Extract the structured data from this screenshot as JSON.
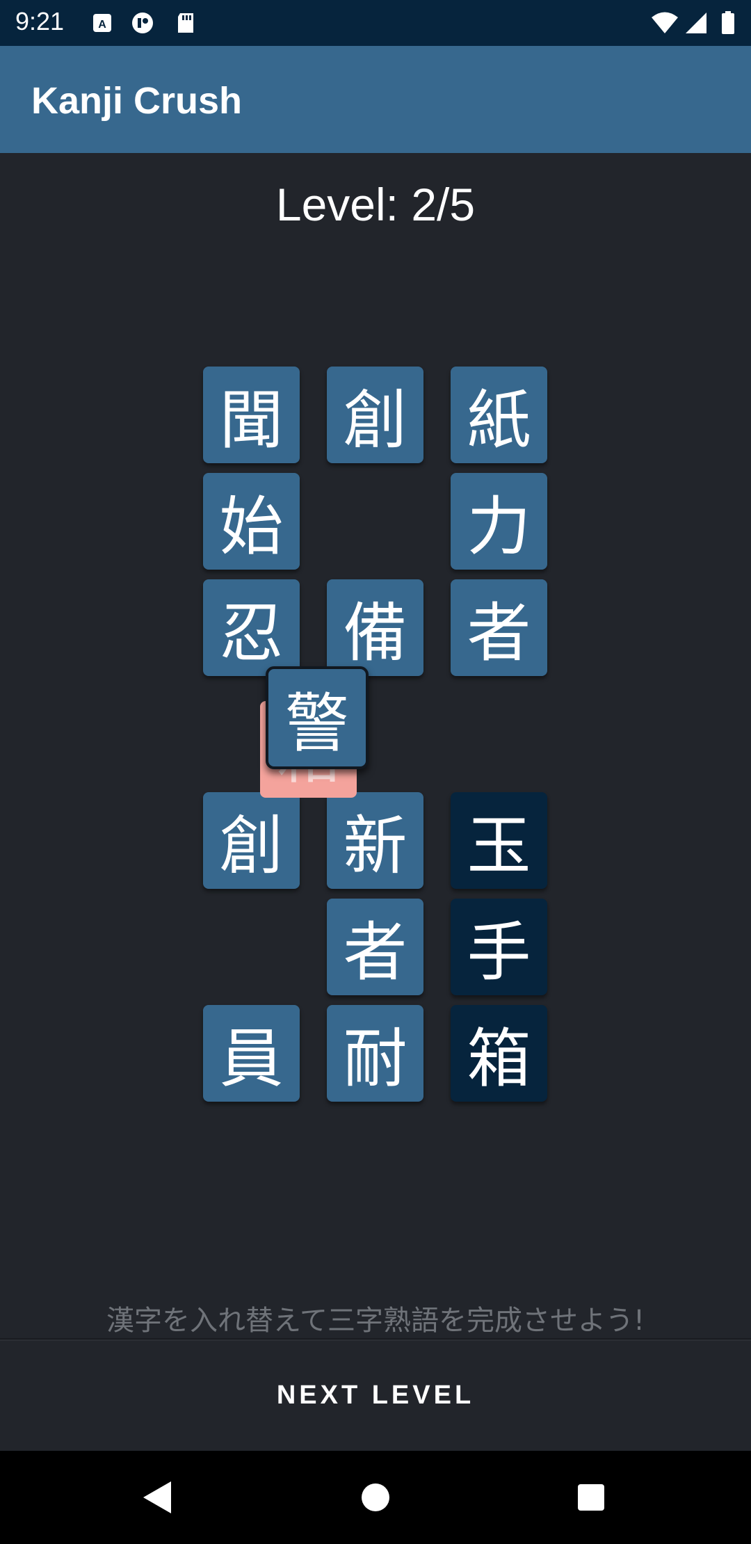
{
  "status_bar": {
    "time": "9:21",
    "icons": [
      "keyboard-a-icon",
      "record-icon",
      "sd-card-icon",
      "wifi-icon",
      "signal-icon",
      "battery-icon"
    ]
  },
  "app_bar": {
    "title": "Kanji Crush",
    "color": "#37688e"
  },
  "game": {
    "level_text": "Level: 2/5",
    "tile_color": "#37688e",
    "completed_tile_color": "#06243d",
    "grid": [
      {
        "r": 0,
        "c": 0,
        "ch": "聞",
        "state": "normal"
      },
      {
        "r": 0,
        "c": 1,
        "ch": "創",
        "state": "normal"
      },
      {
        "r": 0,
        "c": 2,
        "ch": "紙",
        "state": "normal"
      },
      {
        "r": 1,
        "c": 0,
        "ch": "始",
        "state": "normal"
      },
      {
        "r": 1,
        "c": 2,
        "ch": "力",
        "state": "normal"
      },
      {
        "r": 2,
        "c": 0,
        "ch": "忍",
        "state": "normal"
      },
      {
        "r": 2,
        "c": 1,
        "ch": "備",
        "state": "normal"
      },
      {
        "r": 2,
        "c": 2,
        "ch": "者",
        "state": "normal"
      },
      {
        "r": 4,
        "c": 0,
        "ch": "創",
        "state": "normal"
      },
      {
        "r": 4,
        "c": 1,
        "ch": "新",
        "state": "normal"
      },
      {
        "r": 4,
        "c": 2,
        "ch": "玉",
        "state": "done"
      },
      {
        "r": 5,
        "c": 1,
        "ch": "者",
        "state": "normal"
      },
      {
        "r": 5,
        "c": 2,
        "ch": "手",
        "state": "done"
      },
      {
        "r": 6,
        "c": 0,
        "ch": "員",
        "state": "normal"
      },
      {
        "r": 6,
        "c": 1,
        "ch": "耐",
        "state": "normal"
      },
      {
        "r": 6,
        "c": 2,
        "ch": "箱",
        "state": "done"
      }
    ],
    "target_tile": {
      "ch": "箱",
      "color": "#f4a39c"
    },
    "dragged_tile": {
      "ch": "警"
    }
  },
  "hint_text": "漢字を入れ替えて三字熟語を完成させよう!",
  "next_button_label": "NEXT LEVEL",
  "nav_bar": {
    "back": "back-icon",
    "home": "home-icon",
    "recents": "recents-icon"
  }
}
